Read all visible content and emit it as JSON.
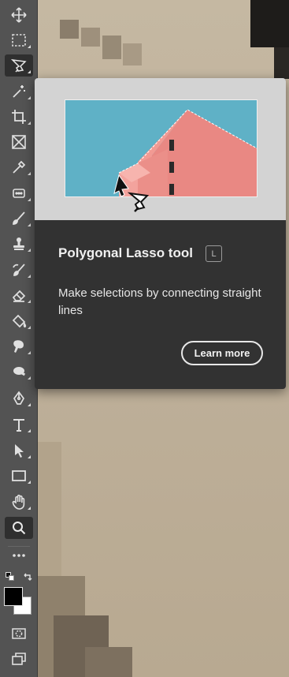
{
  "tooltip": {
    "title": "Polygonal Lasso tool",
    "shortcut": "L",
    "description": "Make selections by connecting straight lines",
    "learn_more": "Learn more"
  },
  "tools": [
    {
      "name": "move-tool",
      "icon": "move-icon"
    },
    {
      "name": "rectangular-marquee-tool",
      "icon": "marquee-icon"
    },
    {
      "name": "polygonal-lasso-tool",
      "icon": "polygonal-lasso-icon",
      "selected": true
    },
    {
      "name": "magic-wand-tool",
      "icon": "magic-wand-icon"
    },
    {
      "name": "crop-tool",
      "icon": "crop-icon"
    },
    {
      "name": "frame-tool",
      "icon": "frame-icon"
    },
    {
      "name": "eyedropper-tool",
      "icon": "eyedropper-icon"
    },
    {
      "name": "spot-healing-tool",
      "icon": "healing-icon"
    },
    {
      "name": "brush-tool",
      "icon": "brush-icon"
    },
    {
      "name": "clone-stamp-tool",
      "icon": "stamp-icon"
    },
    {
      "name": "history-brush-tool",
      "icon": "history-brush-icon"
    },
    {
      "name": "eraser-tool",
      "icon": "eraser-icon"
    },
    {
      "name": "paint-bucket-tool",
      "icon": "paint-bucket-icon"
    },
    {
      "name": "smudge-tool",
      "icon": "smudge-icon"
    },
    {
      "name": "dodge-tool",
      "icon": "dodge-icon"
    },
    {
      "name": "pen-tool",
      "icon": "pen-icon"
    },
    {
      "name": "type-tool",
      "icon": "type-icon"
    },
    {
      "name": "path-selection-tool",
      "icon": "arrow-icon"
    },
    {
      "name": "rectangle-tool",
      "icon": "rectangle-icon"
    },
    {
      "name": "hand-tool",
      "icon": "hand-icon"
    },
    {
      "name": "zoom-tool",
      "icon": "zoom-icon"
    },
    {
      "name": "edit-toolbar",
      "icon": "more-icon"
    }
  ],
  "colors": {
    "toolbar": "#535353",
    "tooltip_bg": "#323232",
    "foreground": "#000000",
    "background": "#ffffff"
  }
}
